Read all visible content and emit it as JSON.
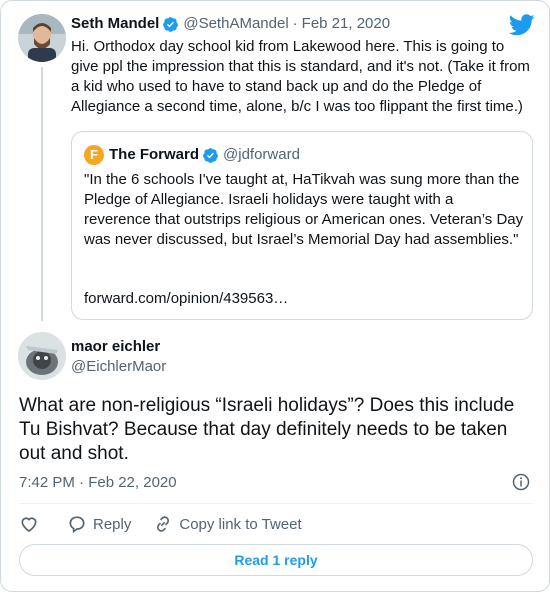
{
  "colors": {
    "accent": "#1d9bf0",
    "muted": "#536471",
    "text": "#0f1419",
    "border": "#cfd9de",
    "forward_logo": "#f5a623"
  },
  "reply_to": {
    "author_name": "Seth Mandel",
    "handle": "@SethAMandel",
    "separator": "·",
    "date": "Feb 21, 2020",
    "text": "Hi. Orthodox day school kid from Lakewood here. This is going to give ppl the impression that this is standard, and it's not. (Take it from a kid who used to have to stand back up and do the Pledge of Allegiance a second time, alone, b/c I was too flippant the first time.)"
  },
  "quoted": {
    "logo_letter": "F",
    "author_name": "The Forward",
    "handle": "@jdforward",
    "text": "\"In the 6 schools I've taught at, HaTikvah was sung more than the Pledge of Allegiance. Israeli holidays were taught with a reverence that outstrips religious or American ones. Veteran’s Day was never discussed, but Israel’s Memorial Day had assemblies.\"",
    "link": "forward.com/opinion/439563…"
  },
  "tweet": {
    "author_name": "maor eichler",
    "handle": "@EichlerMaor",
    "text": "What are non-religious “Israeli holidays”? Does this include Tu Bishvat? Because that day definitely needs to be taken out and shot.",
    "time": "7:42 PM · Feb 22, 2020"
  },
  "actions": {
    "reply": "Reply",
    "copy_link": "Copy link to Tweet"
  },
  "read_replies": "Read 1 reply",
  "icons": [
    "twitter-bird-icon",
    "verified-badge-icon",
    "info-icon",
    "heart-icon",
    "reply-icon",
    "link-icon"
  ]
}
